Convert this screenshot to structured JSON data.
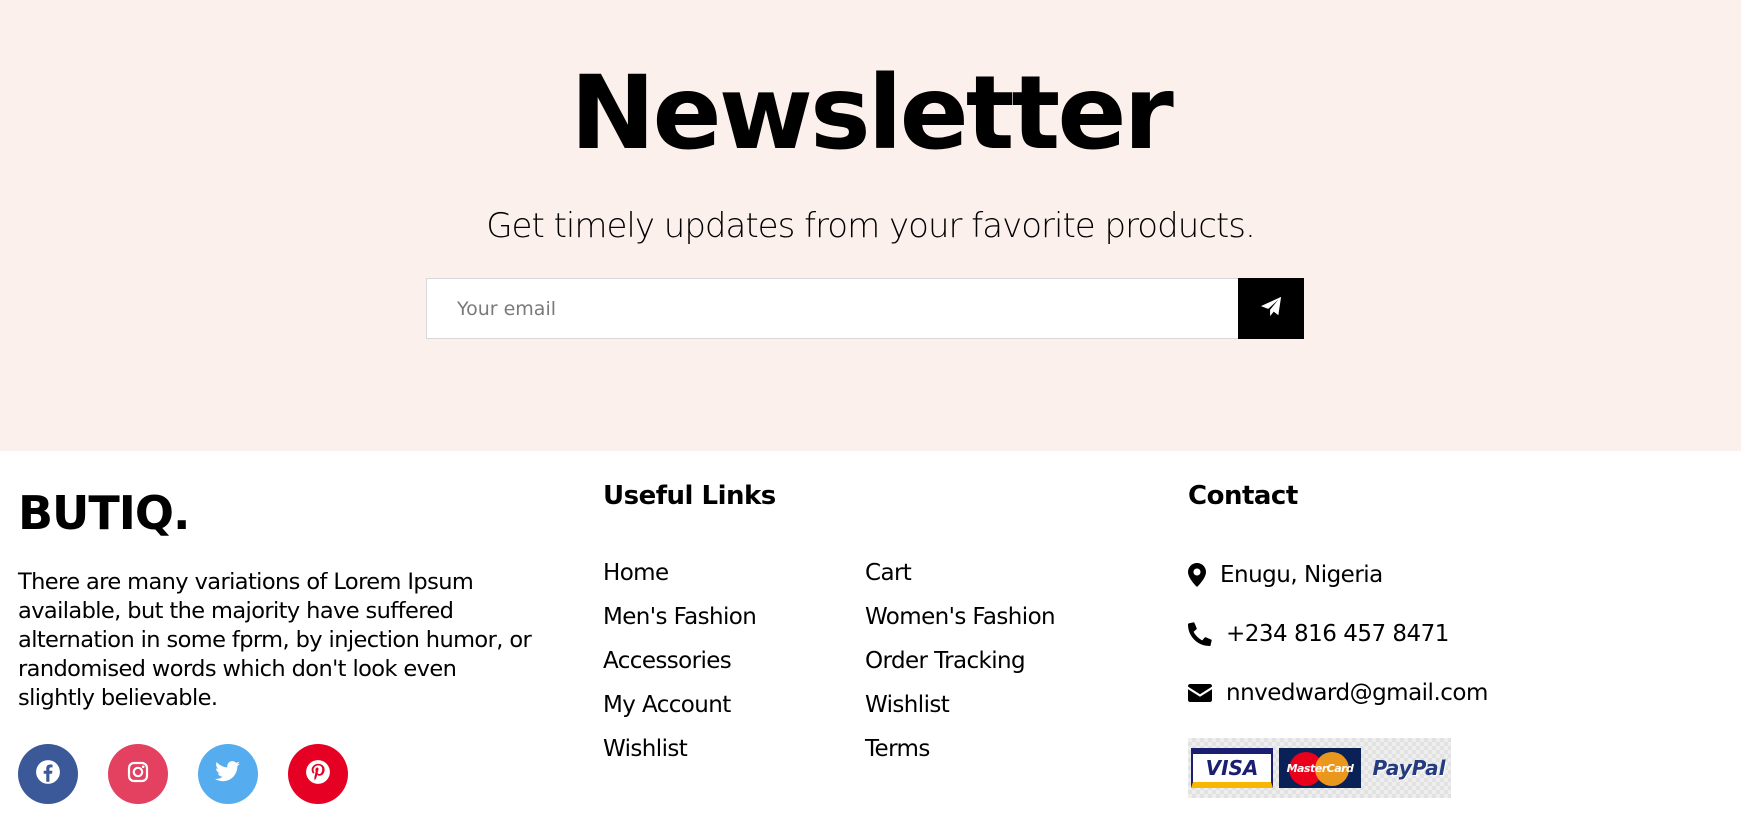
{
  "newsletter": {
    "title": "Newsletter",
    "subtitle": "Get timely updates from your favorite products.",
    "email_placeholder": "Your email",
    "send_icon": "paper-plane-icon"
  },
  "footer": {
    "brand": "BUTIQ.",
    "about": "There are many variations of Lorem Ipsum available, but the majority have suffered alternation in some fprm, by injection humor, or randomised words which don't look even slightly believable.",
    "socials": [
      {
        "name": "facebook",
        "icon": "facebook-icon",
        "color": "#3b5998"
      },
      {
        "name": "instagram",
        "icon": "instagram-icon",
        "color": "#e4405f"
      },
      {
        "name": "twitter",
        "icon": "twitter-icon",
        "color": "#55acee"
      },
      {
        "name": "pinterest",
        "icon": "pinterest-icon",
        "color": "#e60023"
      }
    ],
    "useful_links": {
      "title": "Useful Links",
      "col1": [
        "Home",
        "Men's Fashion",
        "Accessories",
        "My Account",
        "Wishlist"
      ],
      "col2": [
        "Cart",
        "Women's Fashion",
        "Order Tracking",
        "Wishlist",
        "Terms"
      ]
    },
    "contact": {
      "title": "Contact",
      "location": "Enugu, Nigeria",
      "phone": "+234 816 457 8471",
      "email": "nnvedward@gmail.com"
    },
    "payments": {
      "visa": "VISA",
      "mastercard": "MasterCard",
      "paypal": "PayPal"
    }
  },
  "colors": {
    "newsletter_bg": "#fcf0ed",
    "button_bg": "#000000"
  }
}
